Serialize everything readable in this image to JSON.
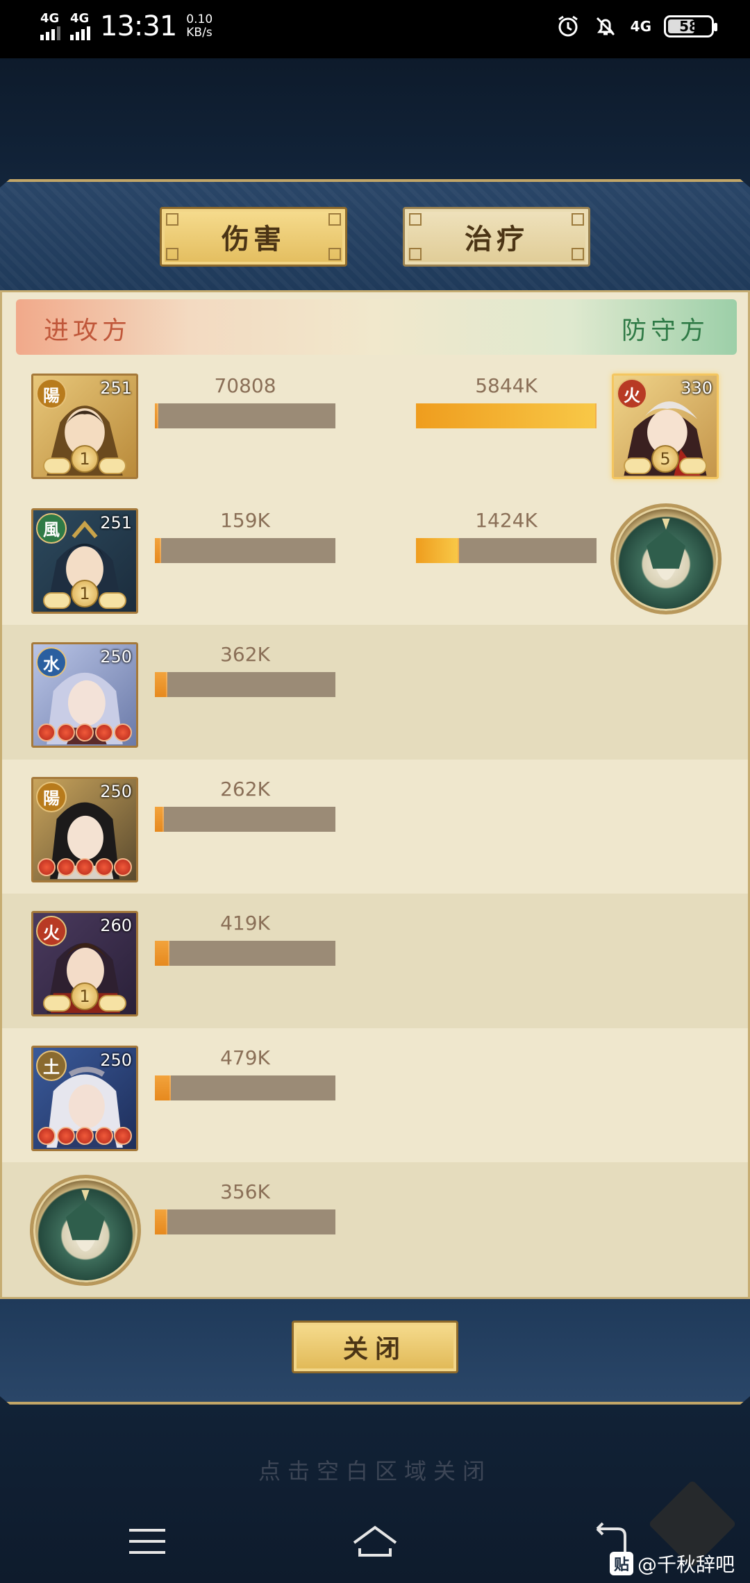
{
  "status_bar": {
    "sim1": "4G",
    "sim2": "4G",
    "time": "13:31",
    "speed_value": "0.10",
    "speed_unit": "KB/s",
    "network": "4G",
    "battery": "58"
  },
  "tabs": {
    "damage": "伤害",
    "heal": "治疗"
  },
  "sides": {
    "attacker": "进攻方",
    "defender": "防守方"
  },
  "rows": [
    {
      "attacker": {
        "element": "陽",
        "element_color": "#b87b1c",
        "level": "251",
        "rank": "coin",
        "stars": "1",
        "value": "70808",
        "fill": 0.02
      },
      "defender": {
        "element": "火",
        "element_color": "#b83a24",
        "level": "330",
        "stars": "5",
        "value": "5844K",
        "fill": 1.0
      }
    },
    {
      "attacker": {
        "element": "風",
        "element_color": "#2f7a46",
        "level": "251",
        "stars": "1",
        "value": "159K",
        "fill": 0.035
      },
      "defender": {
        "type": "dragon",
        "value": "1424K",
        "fill": 0.24
      }
    },
    {
      "attacker": {
        "element": "水",
        "element_color": "#2a5fa0",
        "level": "250",
        "value": "362K",
        "fill": 0.07
      }
    },
    {
      "attacker": {
        "element": "陽",
        "element_color": "#b87b1c",
        "level": "250",
        "value": "262K",
        "fill": 0.05
      }
    },
    {
      "attacker": {
        "element": "火",
        "element_color": "#b83a24",
        "level": "260",
        "stars": "1",
        "value": "419K",
        "fill": 0.08
      }
    },
    {
      "attacker": {
        "element": "土",
        "element_color": "#8a6a2f",
        "level": "250",
        "value": "479K",
        "fill": 0.09
      }
    },
    {
      "attacker": {
        "type": "dragon",
        "value": "356K",
        "fill": 0.07
      }
    }
  ],
  "close_button": "关闭",
  "hint": "点击空白区域关闭",
  "watermark": {
    "logo": "贴",
    "text": "@千秋辞吧"
  }
}
